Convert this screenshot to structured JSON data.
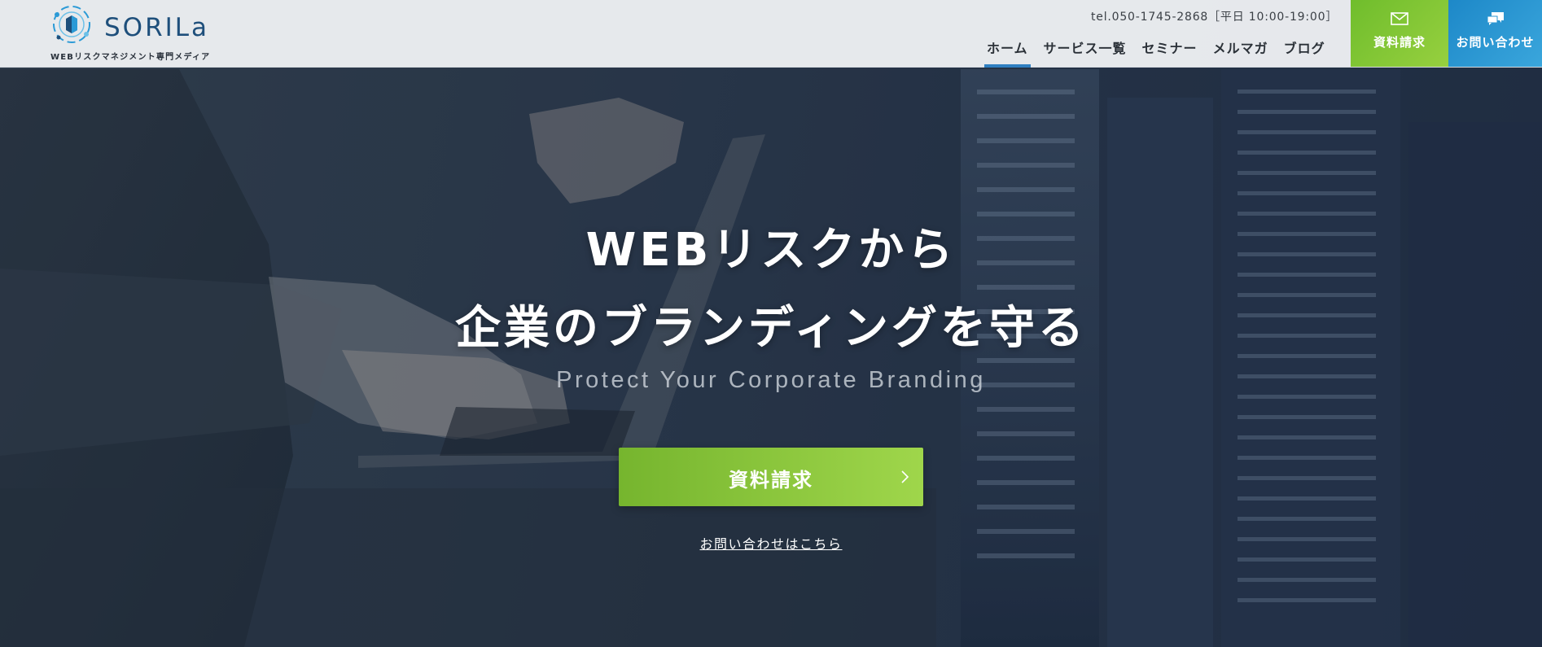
{
  "header": {
    "logo_text": "SORILa",
    "logo_subtitle": "WEBリスクマネジメント専門メディア",
    "tel": "tel.050-1745-2868［平日 10:00-19:00］",
    "nav": [
      {
        "label": "ホーム",
        "active": true
      },
      {
        "label": "サービス一覧",
        "active": false
      },
      {
        "label": "セミナー",
        "active": false
      },
      {
        "label": "メルマガ",
        "active": false
      },
      {
        "label": "ブログ",
        "active": false
      }
    ],
    "request_button": "資料請求",
    "contact_button": "お問い合わせ"
  },
  "hero": {
    "headline_line1": "WEBリスクから",
    "headline_line2": "企業のブランディングを守る",
    "tagline": "Protect Your Corporate Branding",
    "cta_label": "資料請求",
    "contact_link": "お問い合わせはこちら"
  },
  "colors": {
    "accent_green": "#7cbd33",
    "accent_blue": "#2a95d2",
    "brand_navy": "#1e4f7b",
    "active_underline": "#2f7fc1"
  },
  "icons": {
    "logo_mark": "sorila-logo-icon",
    "request_icon": "envelope-icon",
    "contact_icon": "chat-bubbles-icon",
    "cta_arrow": "chevron-right-icon"
  }
}
